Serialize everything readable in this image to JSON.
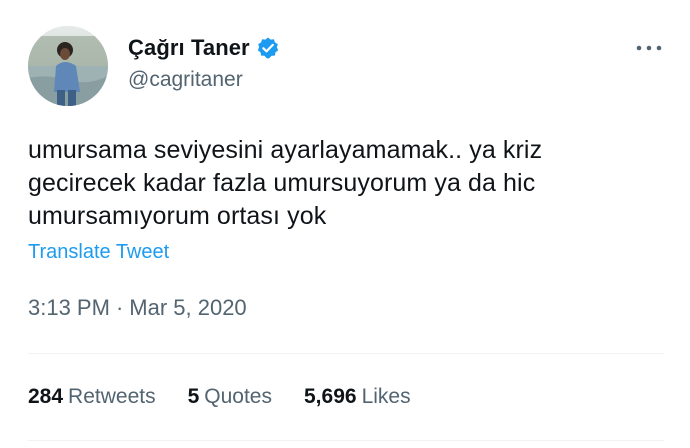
{
  "author": {
    "display_name": "Çağrı Taner",
    "handle": "@cagritaner",
    "verified": true,
    "avatar_icon": "profile-photo"
  },
  "tweet": {
    "lines": [
      "umursama seviyesini ayarlayamamak.. ya kriz",
      "gecirecek kadar fazla umursuyorum ya da hic",
      "umursamıyorum ortası yok"
    ],
    "translate_label": "Translate Tweet",
    "time": "3:13 PM",
    "separator": "·",
    "date": "Mar 5, 2020"
  },
  "stats": {
    "retweets": {
      "count": "284",
      "label": "Retweets"
    },
    "quotes": {
      "count": "5",
      "label": "Quotes"
    },
    "likes": {
      "count": "5,696",
      "label": "Likes"
    }
  },
  "colors": {
    "accent": "#1d9bf0",
    "secondary_text": "#536471",
    "primary_text": "#0f1419",
    "divider": "#eff3f4"
  },
  "icons": {
    "verified": "verified-badge-icon",
    "more": "more-options-icon"
  }
}
